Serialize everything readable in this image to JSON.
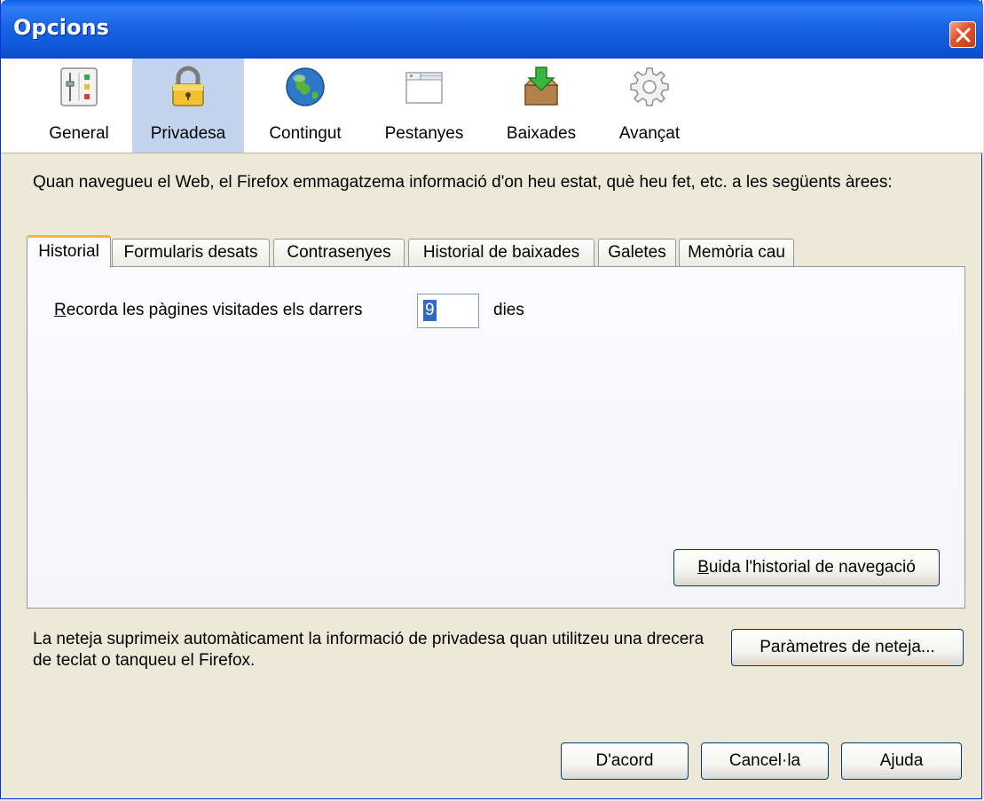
{
  "window": {
    "title": "Opcions"
  },
  "toolbar": {
    "items": [
      {
        "label": "General",
        "icon": "general-settings-icon"
      },
      {
        "label": "Privadesa",
        "icon": "padlock-icon",
        "selected": true
      },
      {
        "label": "Contingut",
        "icon": "globe-icon"
      },
      {
        "label": "Pestanyes",
        "icon": "tabs-window-icon"
      },
      {
        "label": "Baixades",
        "icon": "download-box-icon"
      },
      {
        "label": "Avançat",
        "icon": "gear-icon"
      }
    ]
  },
  "privacy": {
    "description": "Quan navegueu el Web, el Firefox emmagatzema informació d'on heu estat, què heu fet, etc. a les següents àrees:",
    "tabs": [
      {
        "label": "Historial",
        "active": true
      },
      {
        "label": "Formularis desats"
      },
      {
        "label": "Contrasenyes"
      },
      {
        "label": "Historial de baixades"
      },
      {
        "label": "Galetes"
      },
      {
        "label": "Memòria cau"
      }
    ],
    "history": {
      "remember_label_accel": "R",
      "remember_label_rest": "ecorda les pàgines visitades els darrers",
      "days_value": "9",
      "days_unit": "dies",
      "clear_button_accel": "B",
      "clear_button_rest": "uida l'historial de navegació"
    },
    "cleanup_text": "La neteja suprimeix automàticament la informació de privadesa quan utilitzeu una drecera de teclat o tanqueu el Firefox.",
    "cleanup_settings_button": "Paràmetres de neteja..."
  },
  "footer": {
    "ok_label": "D'acord",
    "cancel_label": "Cancel·la",
    "help_label": "Ajuda"
  },
  "colors": {
    "titlebar": "#0a5fe6",
    "selected_toolbar": "#c3d5ee",
    "active_tab_accent": "#f9b542",
    "dialog_bg": "#ece9d8"
  }
}
